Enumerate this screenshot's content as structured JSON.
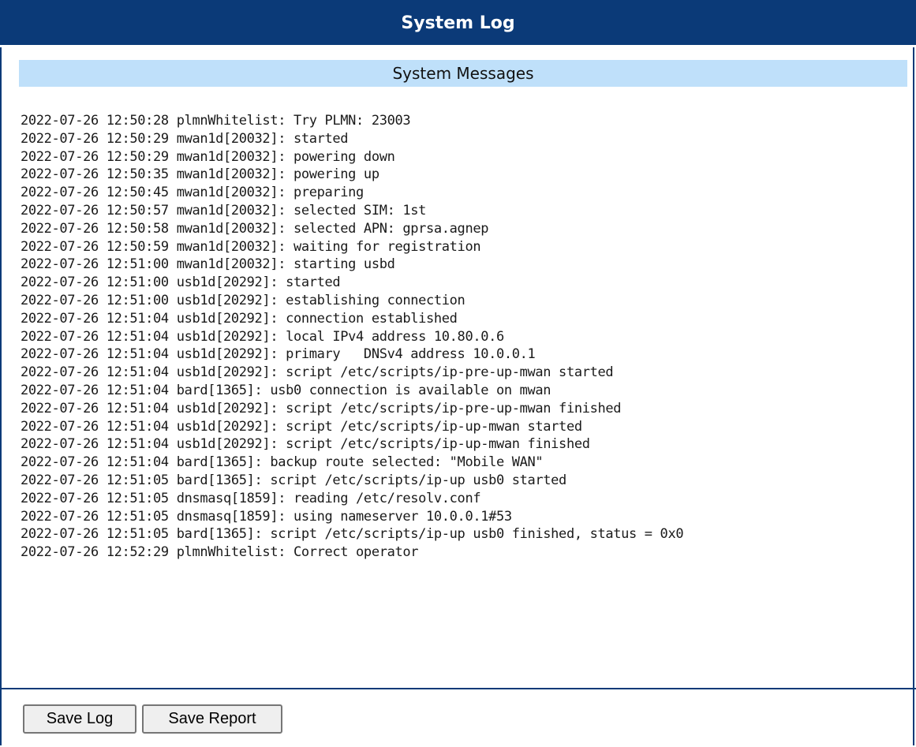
{
  "window": {
    "title": "System Log"
  },
  "section": {
    "heading": "System Messages"
  },
  "log_lines": [
    "2022-07-26 12:50:28 plmnWhitelist: Try PLMN: 23003",
    "2022-07-26 12:50:29 mwan1d[20032]: started",
    "2022-07-26 12:50:29 mwan1d[20032]: powering down",
    "2022-07-26 12:50:35 mwan1d[20032]: powering up",
    "2022-07-26 12:50:45 mwan1d[20032]: preparing",
    "2022-07-26 12:50:57 mwan1d[20032]: selected SIM: 1st",
    "2022-07-26 12:50:58 mwan1d[20032]: selected APN: gprsa.agnep",
    "2022-07-26 12:50:59 mwan1d[20032]: waiting for registration",
    "2022-07-26 12:51:00 mwan1d[20032]: starting usbd",
    "2022-07-26 12:51:00 usb1d[20292]: started",
    "2022-07-26 12:51:00 usb1d[20292]: establishing connection",
    "2022-07-26 12:51:04 usb1d[20292]: connection established",
    "2022-07-26 12:51:04 usb1d[20292]: local IPv4 address 10.80.0.6",
    "2022-07-26 12:51:04 usb1d[20292]: primary   DNSv4 address 10.0.0.1",
    "2022-07-26 12:51:04 usb1d[20292]: script /etc/scripts/ip-pre-up-mwan started",
    "2022-07-26 12:51:04 bard[1365]: usb0 connection is available on mwan",
    "2022-07-26 12:51:04 usb1d[20292]: script /etc/scripts/ip-pre-up-mwan finished",
    "2022-07-26 12:51:04 usb1d[20292]: script /etc/scripts/ip-up-mwan started",
    "2022-07-26 12:51:04 usb1d[20292]: script /etc/scripts/ip-up-mwan finished",
    "2022-07-26 12:51:04 bard[1365]: backup route selected: \"Mobile WAN\"",
    "2022-07-26 12:51:05 bard[1365]: script /etc/scripts/ip-up usb0 started",
    "2022-07-26 12:51:05 dnsmasq[1859]: reading /etc/resolv.conf",
    "2022-07-26 12:51:05 dnsmasq[1859]: using nameserver 10.0.0.1#53",
    "2022-07-26 12:51:05 bard[1365]: script /etc/scripts/ip-up usb0 finished, status = 0x0",
    "2022-07-26 12:52:29 plmnWhitelist: Correct operator"
  ],
  "buttons": {
    "save_log": "Save Log",
    "save_report": "Save Report"
  },
  "colors": {
    "title_bar": "#0b3a78",
    "subheader": "#bfe0fa"
  }
}
